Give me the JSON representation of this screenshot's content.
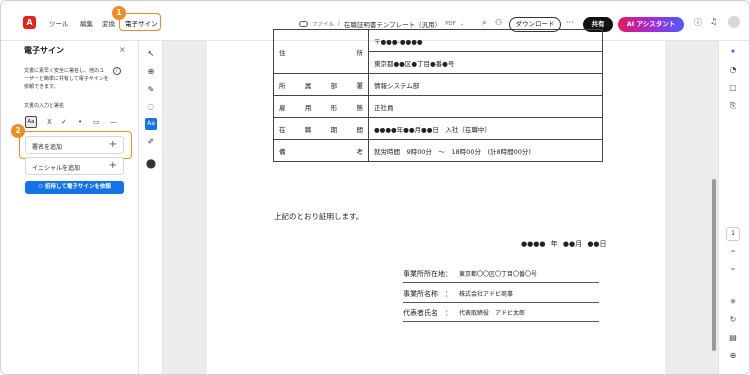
{
  "topbar": {
    "menu": [
      "ツール",
      "編集",
      "変換",
      "電子サイン"
    ],
    "file_label": "ファイル",
    "file_name": "在職証明書テンプレート（汎用）",
    "file_type": "PDF",
    "download": "ダウンロード",
    "more": "···",
    "share": "共有",
    "ai_assistant": "AI アシスタント"
  },
  "annotations": {
    "badge1": "1",
    "badge2": "2"
  },
  "panel": {
    "title": "電子サイン",
    "close": "×",
    "description": "文書に素早く安全に署名し、他のユーザーと簡単に共有して電子サインを依頼できます。",
    "section_label": "文書の入力と署名",
    "tools": {
      "aa": "Aa",
      "x": "X",
      "check": "✓",
      "dot": "•",
      "rect": "▭",
      "line": "—"
    },
    "add_signature": "署名を追加",
    "add_initials": "イニシャルを追加",
    "plus": "+",
    "request_button": "招待して電子サインを依頼"
  },
  "document": {
    "rows": [
      {
        "label": [
          "住",
          "所"
        ],
        "values": [
          "〒●●●-●●●●",
          "東京都●●区●丁目●番●号"
        ]
      },
      {
        "label": [
          "所",
          "属",
          "部",
          "署"
        ],
        "values": [
          "情報システム部"
        ]
      },
      {
        "label": [
          "雇",
          "用",
          "形",
          "態"
        ],
        "values": [
          "正社員"
        ]
      },
      {
        "label": [
          "在",
          "職",
          "期",
          "間"
        ],
        "values": [
          "●●●●年●●月●●日　入社（在職中）"
        ]
      },
      {
        "label": [
          "備",
          "考"
        ],
        "values": [
          "就労時間　9時00分　～　18時00分　(計8時間00分)"
        ]
      }
    ],
    "certification": "上記のとおり証明します。",
    "date": "●●●● 年 ●●月 ●●日",
    "signatures": [
      {
        "key": "事業所所在地：",
        "value": "東京都〇〇区〇丁目〇番〇号"
      },
      {
        "key": "事業所名称　：",
        "value": "株式会社アドビ商事"
      },
      {
        "key": "代表者氏名　：",
        "value": "代表取締役　アドビ太郎"
      }
    ]
  },
  "rail": {
    "page_number": "1"
  },
  "colors": {
    "accent": "#1473e6",
    "annotation": "#f08a24",
    "brand_red": "#e1251b"
  }
}
